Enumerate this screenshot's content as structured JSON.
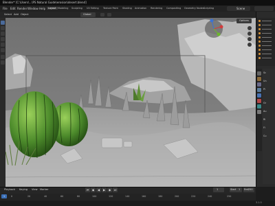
{
  "window": {
    "title": "Blender* [C:\\Users\\...\\PS Natural Guide\\erosion\\desert.blend]"
  },
  "menubar": {
    "items": [
      "File",
      "Edit",
      "Render",
      "Window",
      "Help"
    ],
    "workspace_tabs": [
      "Layout",
      "Modeling",
      "Sculpting",
      "UV Editing",
      "Texture Paint",
      "Shading",
      "Animation",
      "Rendering",
      "Compositing",
      "Geometry Nodes",
      "Scripting"
    ],
    "active_tab": "Layout",
    "scene": "Scene"
  },
  "toolbar": {
    "items": [
      "Select",
      "Add",
      "Object"
    ],
    "transform_orientation": "Global"
  },
  "viewport": {
    "options_label": "Options"
  },
  "properties": {
    "labels": [
      "Sc",
      "Un",
      "Pi",
      "Gr",
      "Au",
      "Ri",
      "Fi",
      "Cu"
    ]
  },
  "timeline": {
    "items": [
      "Playback",
      "Keying",
      "View",
      "Marker"
    ],
    "current_frame": "1",
    "start_label": "Start",
    "start": "1",
    "end_label": "End",
    "end": "250",
    "playhead": "1",
    "ticks": [
      "0",
      "20",
      "40",
      "60",
      "80",
      "100",
      "120",
      "140",
      "160",
      "180",
      "200",
      "220",
      "240",
      "250"
    ]
  },
  "status": {
    "version": "3.1.0"
  },
  "colors": {
    "accent": "#4772b3",
    "orange": "#d08f3a",
    "cactus": "#4c8a2b"
  }
}
